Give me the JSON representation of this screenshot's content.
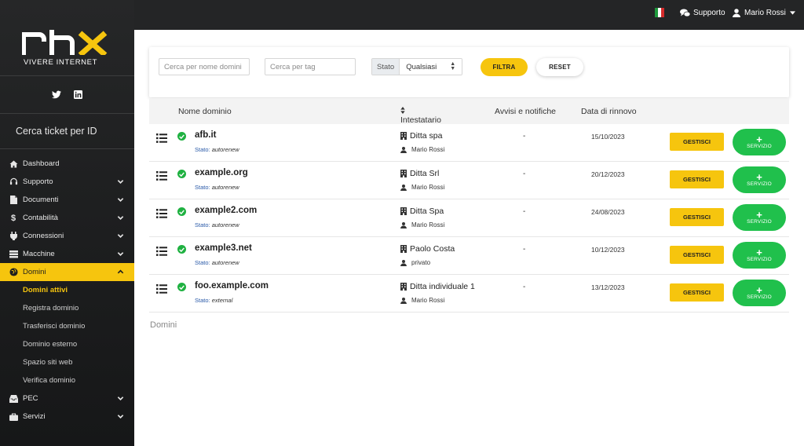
{
  "brand": {
    "logo_text": "rhx",
    "tagline": "VIVERE INTERNET"
  },
  "social": [
    {
      "icon": "twitter-icon"
    },
    {
      "icon": "linkedin-icon"
    }
  ],
  "sidebar": {
    "ticket_search": "Cerca ticket per ID",
    "items": [
      {
        "label": "Dashboard",
        "icon": "home-icon"
      },
      {
        "label": "Supporto",
        "icon": "headset-icon"
      },
      {
        "label": "Documenti",
        "icon": "document-icon"
      },
      {
        "label": "Contabilità",
        "icon": "dollar-icon"
      },
      {
        "label": "Connessioni",
        "icon": "plug-icon"
      },
      {
        "label": "Macchine",
        "icon": "server-icon"
      },
      {
        "label": "Domini",
        "icon": "globe-icon"
      },
      {
        "label": "Domini attivi"
      },
      {
        "label": "Registra dominio"
      },
      {
        "label": "Trasferisci dominio"
      },
      {
        "label": "Dominio esterno"
      },
      {
        "label": "Spazio siti web"
      },
      {
        "label": "Verifica dominio"
      },
      {
        "label": "PEC",
        "icon": "inbox-icon"
      },
      {
        "label": "Servizi",
        "icon": "briefcase-icon"
      }
    ]
  },
  "topbar": {
    "support_label": "Supporto",
    "user_name": "Mario Rossi"
  },
  "filters": {
    "name_placeholder": "Cerca per nome domini",
    "tag_placeholder": "Cerca per tag",
    "stato_label": "Stato",
    "stato_value": "Qualsiasi",
    "filter_button": "FILTRA",
    "reset_button": "RESET"
  },
  "table": {
    "columns": [
      "Nome dominio",
      "Intestatario",
      "Avvisi e notifiche",
      "Data di rinnovo"
    ],
    "rows": [
      {
        "domain": "afb.it",
        "stato_label": "Stato:",
        "stato": "autorenew",
        "owner": "Ditta spa",
        "contact": "Mario Rossi",
        "alerts": "-",
        "renewal": "15/10/2023",
        "manage": "GESTISCI",
        "plus": "+",
        "service": "SERVIZIO"
      },
      {
        "domain": "example.org",
        "stato_label": "Stato:",
        "stato": "autorenew",
        "owner": "Ditta Srl",
        "contact": "Mario Rossi",
        "alerts": "-",
        "renewal": "20/12/2023",
        "manage": "GESTISCI",
        "plus": "+",
        "service": "SERVIZIO"
      },
      {
        "domain": "example2.com",
        "stato_label": "Stato:",
        "stato": "autorenew",
        "owner": "Ditta Spa",
        "contact": "Mario Rossi",
        "alerts": "-",
        "renewal": "24/08/2023",
        "manage": "GESTISCI",
        "plus": "+",
        "service": "SERVIZIO"
      },
      {
        "domain": "example3.net",
        "stato_label": "Stato:",
        "stato": "autorenew",
        "owner": "Paolo Costa",
        "contact": "privato",
        "alerts": "-",
        "renewal": "10/12/2023",
        "manage": "GESTISCI",
        "plus": "+",
        "service": "SERVIZIO"
      },
      {
        "domain": "foo.example.com",
        "stato_label": "Stato:",
        "stato": "external",
        "owner": "Ditta individuale 1",
        "contact": "Mario Rossi",
        "alerts": "-",
        "renewal": "13/12/2023",
        "manage": "GESTISCI",
        "plus": "+",
        "service": "SERVIZIO"
      }
    ]
  },
  "footer_label": "Domini",
  "colors": {
    "accent": "#f6c50e",
    "success": "#20c04c",
    "sidebar_bg": "#1f2021",
    "topbar_bg": "#242526",
    "status_blue": "#2a5aa8"
  }
}
